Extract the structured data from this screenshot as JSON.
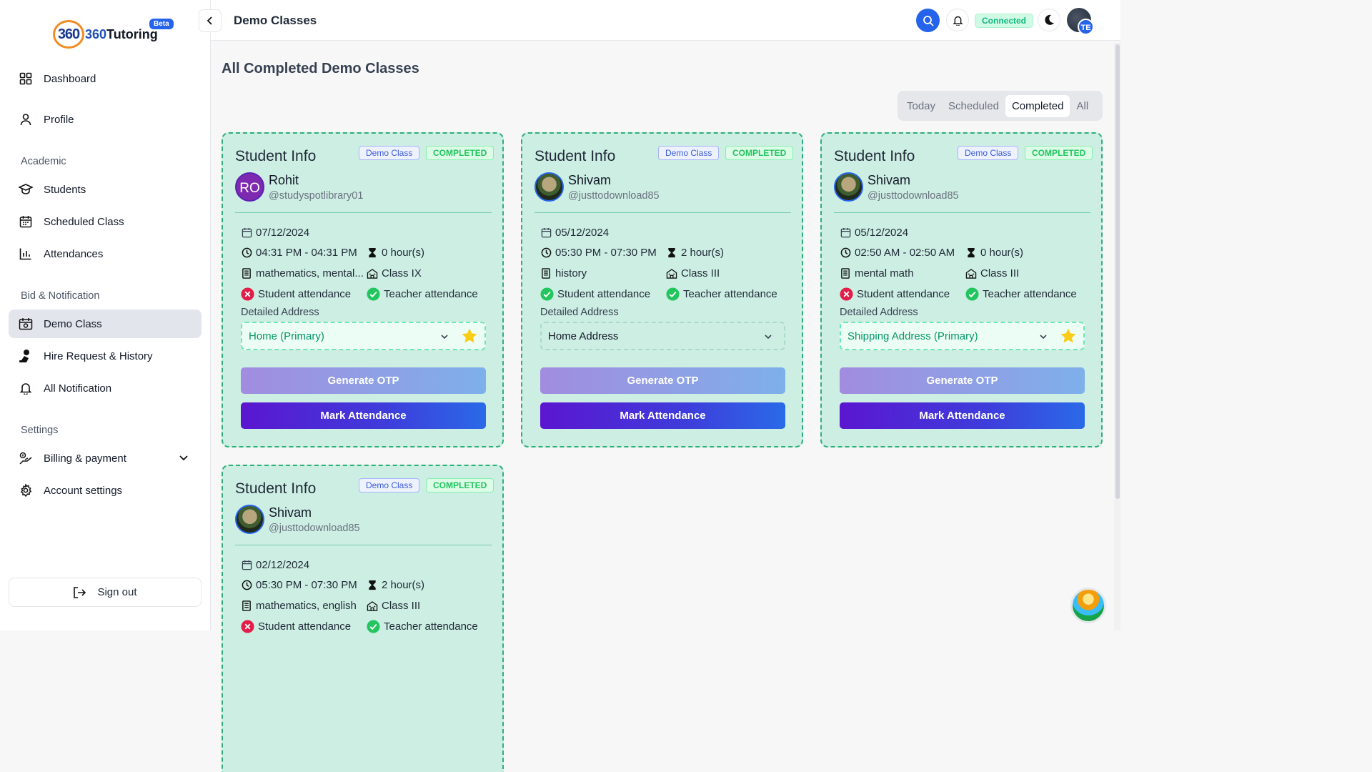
{
  "app": {
    "logo_mark": "360",
    "logo_text_prefix": "360",
    "logo_text": "Tutoring",
    "beta": "Beta"
  },
  "sidebar": {
    "items": [
      {
        "label": "Dashboard"
      },
      {
        "label": "Profile"
      }
    ],
    "sections": [
      {
        "title": "Academic",
        "items": [
          {
            "label": "Students"
          },
          {
            "label": "Scheduled Class"
          },
          {
            "label": "Attendances"
          }
        ]
      },
      {
        "title": "Bid & Notification",
        "items": [
          {
            "label": "Demo Class"
          },
          {
            "label": "Hire Request & History"
          },
          {
            "label": "All Notification"
          }
        ]
      },
      {
        "title": "Settings",
        "items": [
          {
            "label": "Billing & payment"
          },
          {
            "label": "Account settings"
          }
        ]
      }
    ],
    "sign_out": "Sign out"
  },
  "header": {
    "title": "Demo Classes",
    "status": "Connected",
    "user_initials": "TE"
  },
  "main": {
    "title": "All Completed Demo Classes",
    "tabs": [
      {
        "label": "Today"
      },
      {
        "label": "Scheduled"
      },
      {
        "label": "Completed"
      },
      {
        "label": "All"
      }
    ],
    "active_tab": "Completed",
    "cards": [
      {
        "heading": "Student Info",
        "badge_type": "Demo Class",
        "badge_status": "COMPLETED",
        "avatar_initials": "RO",
        "name": "Rohit",
        "handle": "@studyspotlibrary01",
        "date": "07/12/2024",
        "time": "04:31 PM - 04:31 PM",
        "duration": "0 hour(s)",
        "subjects": "mathematics, mental...",
        "class": "Class IX",
        "student_attendance": "Student attendance",
        "teacher_attendance": "Teacher attendance",
        "address_label": "Detailed Address",
        "address": "Home (Primary)",
        "otp": "Generate OTP",
        "mark": "Mark Attendance"
      },
      {
        "heading": "Student Info",
        "badge_type": "Demo Class",
        "badge_status": "COMPLETED",
        "name": "Shivam",
        "handle": "@justtodownload85",
        "date": "05/12/2024",
        "time": "05:30 PM - 07:30 PM",
        "duration": "2 hour(s)",
        "subjects": "history",
        "class": "Class III",
        "student_attendance": "Student attendance",
        "teacher_attendance": "Teacher attendance",
        "address_label": "Detailed Address",
        "address": "Home Address",
        "otp": "Generate OTP",
        "mark": "Mark Attendance"
      },
      {
        "heading": "Student Info",
        "badge_type": "Demo Class",
        "badge_status": "COMPLETED",
        "name": "Shivam",
        "handle": "@justtodownload85",
        "date": "05/12/2024",
        "time": "02:50 AM - 02:50 AM",
        "duration": "0 hour(s)",
        "subjects": "mental math",
        "class": "Class III",
        "student_attendance": "Student attendance",
        "teacher_attendance": "Teacher attendance",
        "address_label": "Detailed Address",
        "address": "Shipping Address (Primary)",
        "otp": "Generate OTP",
        "mark": "Mark Attendance"
      },
      {
        "heading": "Student Info",
        "badge_type": "Demo Class",
        "badge_status": "COMPLETED",
        "name": "Shivam",
        "handle": "@justtodownload85",
        "date": "02/12/2024",
        "time": "05:30 PM - 07:30 PM",
        "duration": "2 hour(s)",
        "subjects": "mathematics, english",
        "class": "Class III",
        "student_attendance": "Student attendance",
        "teacher_attendance": "Teacher attendance"
      }
    ]
  },
  "colors": {
    "accent": "#2563eb",
    "card_bg": "#cdeee3",
    "card_border": "#2fae7b",
    "success": "#22c55e",
    "error": "#e11d48"
  }
}
